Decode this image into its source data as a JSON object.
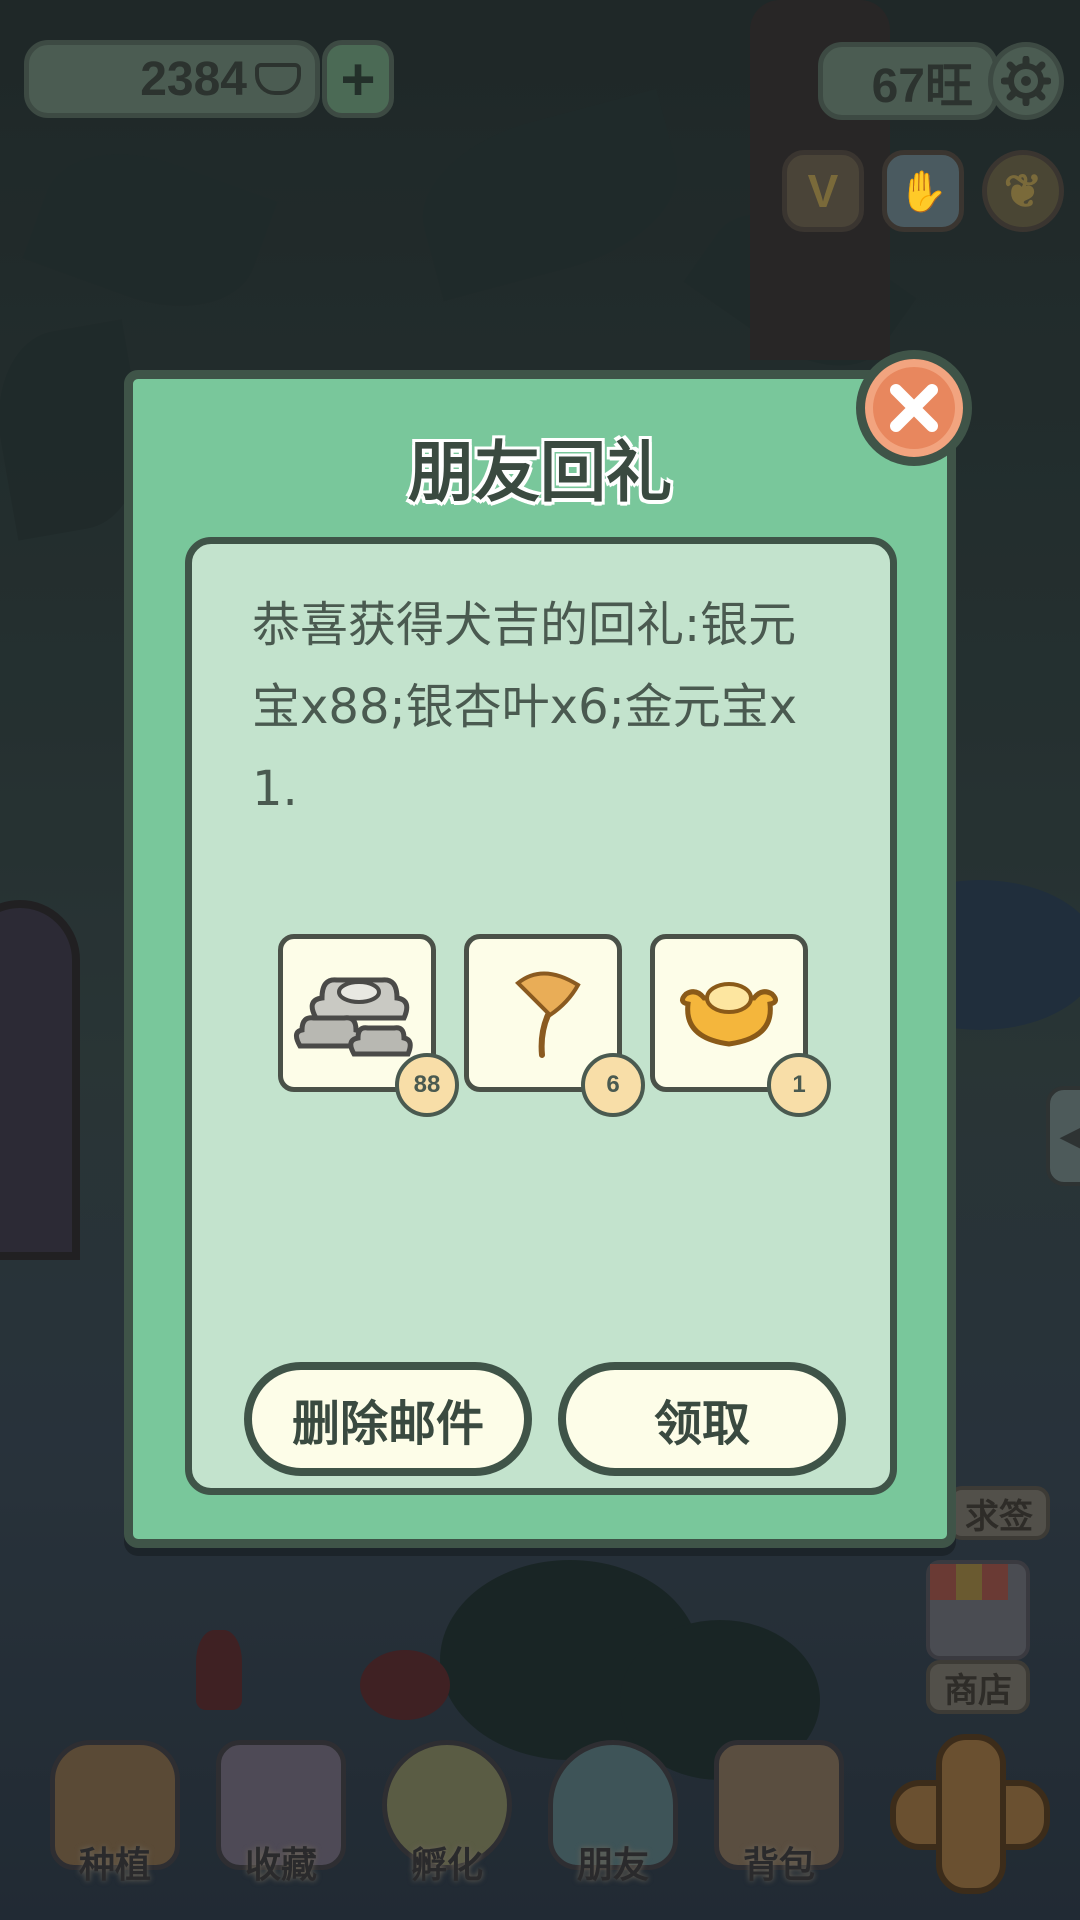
{
  "hud": {
    "coins": "2384",
    "coin_icon": "silver-ingot-icon",
    "plus_label": "+",
    "wang": "67旺",
    "settings_icon": "gear-icon",
    "quick_icons": [
      {
        "name": "vip-icon",
        "glyph": "V"
      },
      {
        "name": "hand-icon",
        "glyph": "✋"
      },
      {
        "name": "ginkgo-leaf-icon",
        "glyph": "❦"
      }
    ]
  },
  "side": {
    "lottery_label": "求签",
    "shop_label": "商店"
  },
  "nav": {
    "items": [
      {
        "label": "种植"
      },
      {
        "label": "收藏"
      },
      {
        "label": "孵化"
      },
      {
        "label": "朋友"
      },
      {
        "label": "背包"
      }
    ]
  },
  "modal": {
    "title": "朋友回礼",
    "message": "恭喜获得犬吉的回礼:银元宝x88;银杏叶x6;金元宝x1.",
    "rewards": [
      {
        "icon": "silver-ingot-icon",
        "qty": "88"
      },
      {
        "icon": "ginkgo-leaf-icon",
        "qty": "6"
      },
      {
        "icon": "gold-ingot-icon",
        "qty": "1"
      }
    ],
    "delete_label": "删除邮件",
    "claim_label": "领取"
  },
  "colors": {
    "modal_bg": "#79c79b",
    "panel_bg": "#c3e3cd",
    "border": "#3f5448",
    "close_bg": "#e8875e",
    "badge_bg": "#f8dea8"
  }
}
